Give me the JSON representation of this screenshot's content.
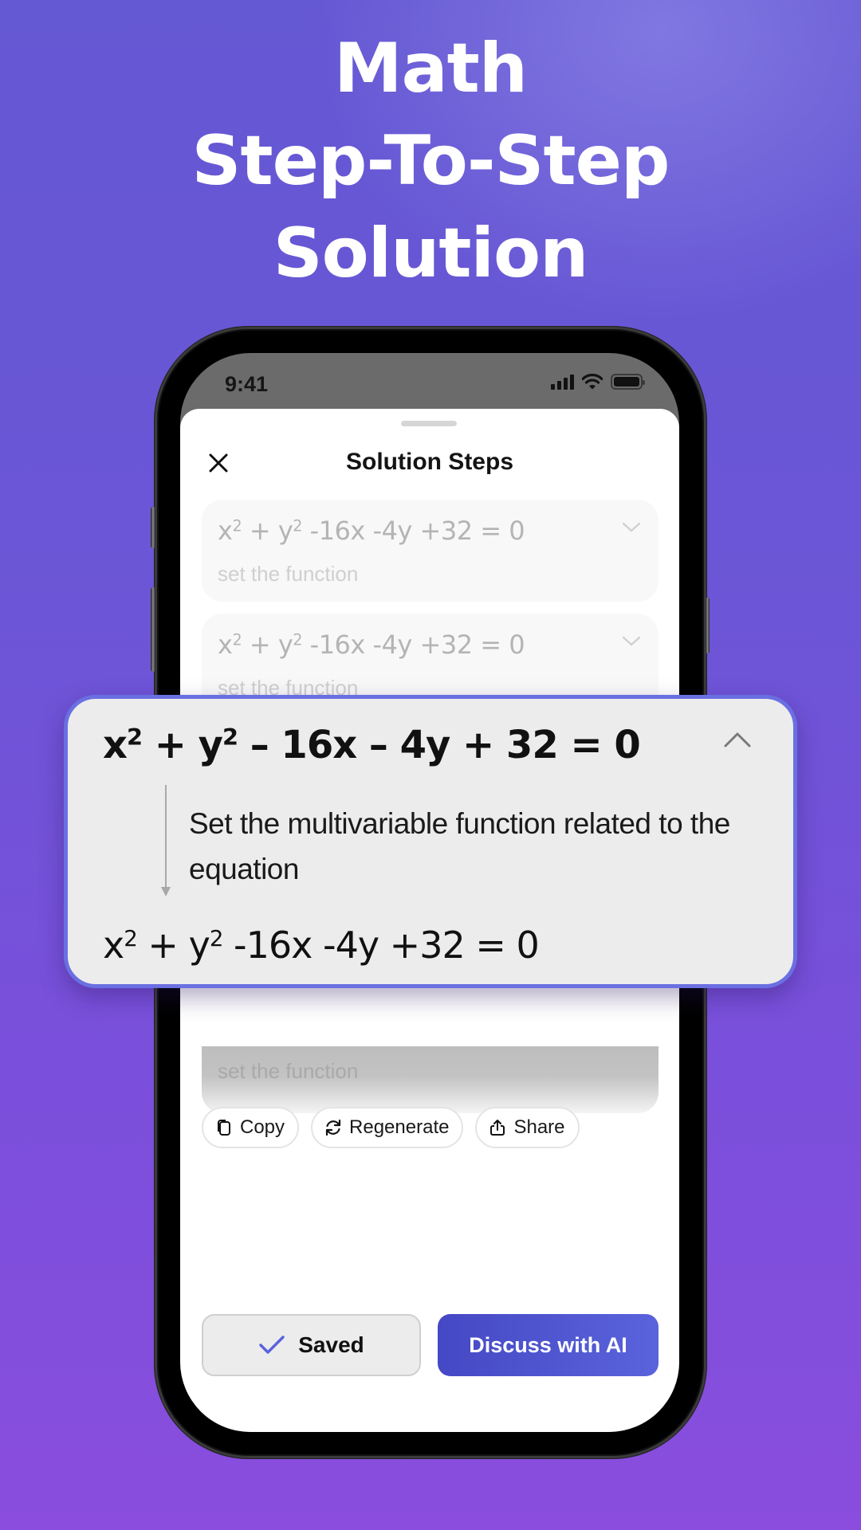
{
  "hero": {
    "line1": "Math",
    "line2": "Step-To-Step",
    "line3": "Solution"
  },
  "status_bar": {
    "time": "9:41",
    "icons": [
      "cellular-signal-icon",
      "wifi-icon",
      "battery-icon"
    ]
  },
  "sheet": {
    "title": "Solution Steps",
    "close_icon": "close-icon"
  },
  "steps": [
    {
      "eq_parts": [
        "x",
        "2",
        " + y",
        "2",
        " -16x -4y +32 = 0"
      ],
      "desc": "set the function",
      "state": "collapsed"
    },
    {
      "eq_parts": [
        "x",
        "2",
        " + y",
        "2",
        " -16x -4y +32 = 0"
      ],
      "desc": "set the function",
      "state": "collapsed"
    },
    {
      "desc": "set the function",
      "state": "collapsed"
    }
  ],
  "popup": {
    "title_parts": [
      "x",
      "2",
      " + y",
      "2",
      " – 16x – 4y + 32 = 0"
    ],
    "description": "Set the multivariable function related to the equation",
    "result_parts": [
      "x",
      "2",
      " + y",
      "2",
      " -16x -4y +32 = 0"
    ],
    "state": "expanded"
  },
  "actions": {
    "copy": "Copy",
    "regenerate": "Regenerate",
    "share": "Share"
  },
  "bottom": {
    "saved": "Saved",
    "discuss": "Discuss with AI"
  },
  "colors": {
    "accent": "#5a63dc",
    "accent_dark": "#4548c4",
    "popup_border": "#6a6fe2",
    "check": "#5a63dc"
  }
}
